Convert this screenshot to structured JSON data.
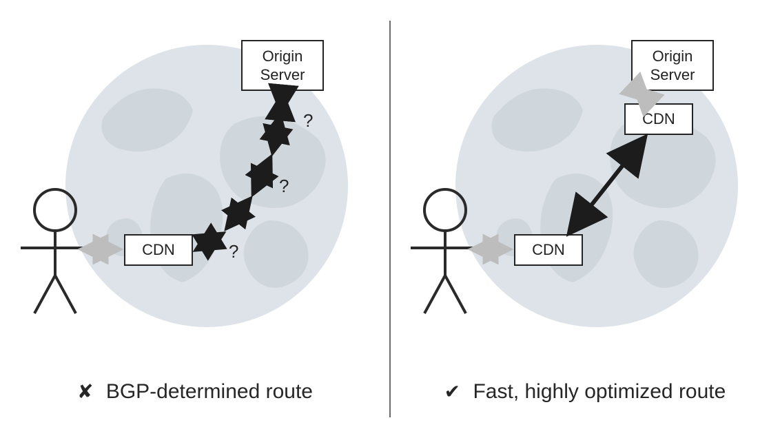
{
  "left": {
    "origin_label": "Origin\nServer",
    "cdn_label": "CDN",
    "qmarks": [
      "?",
      "?",
      "?"
    ],
    "caption_icon": "✘",
    "caption_text": "BGP-determined route"
  },
  "right": {
    "origin_label": "Origin\nServer",
    "cdn_top_label": "CDN",
    "cdn_bottom_label": "CDN",
    "caption_icon": "✔",
    "caption_text": "Fast, highly optimized route"
  },
  "colors": {
    "globe": "#dde3e8",
    "arrow_dark": "#1c1c1c",
    "arrow_light": "#bdbdbd"
  }
}
